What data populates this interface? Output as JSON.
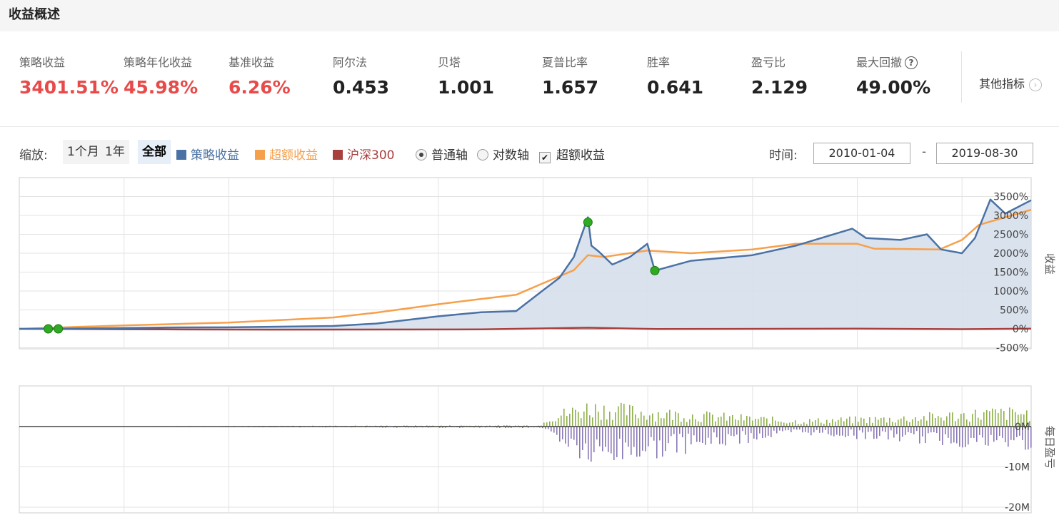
{
  "header": {
    "title": "收益概述"
  },
  "metrics": [
    {
      "label": "策略收益",
      "value": "3401.51%",
      "color": "#e84a4a"
    },
    {
      "label": "策略年化收益",
      "value": "45.98%",
      "color": "#e84a4a"
    },
    {
      "label": "基准收益",
      "value": "6.26%",
      "color": "#e84a4a"
    },
    {
      "label": "阿尔法",
      "value": "0.453",
      "color": "#222222"
    },
    {
      "label": "贝塔",
      "value": "1.001",
      "color": "#222222"
    },
    {
      "label": "夏普比率",
      "value": "1.657",
      "color": "#222222"
    },
    {
      "label": "胜率",
      "value": "0.641",
      "color": "#222222"
    },
    {
      "label": "盈亏比",
      "value": "2.129",
      "color": "#222222"
    },
    {
      "label": "最大回撤",
      "value": "49.00%",
      "color": "#222222",
      "icon": "help-icon"
    }
  ],
  "more_metrics": {
    "label": "其他指标",
    "icon": "chevron-right-circle-icon"
  },
  "toolbar": {
    "zoom_label": "缩放:",
    "zoom_buttons": [
      "1个月",
      "1年",
      "全部"
    ],
    "zoom_active": "全部",
    "legend": [
      {
        "label": "策略收益",
        "color": "#4a72a4"
      },
      {
        "label": "超额收益",
        "color": "#f7a04b"
      },
      {
        "label": "沪深300",
        "color": "#a8403e"
      }
    ],
    "axis_modes": [
      {
        "label": "普通轴",
        "checked": true
      },
      {
        "label": "对数轴",
        "checked": false
      }
    ],
    "excess_checkbox": {
      "label": "超额收益",
      "checked": true
    },
    "time_label": "时间:",
    "date_from": "2010-01-04",
    "date_to": "2019-08-30",
    "date_dash": "-"
  },
  "chart_data": [
    {
      "type": "line",
      "ylabel": "收益",
      "x_range": [
        "2010-01-04",
        "2019-08-30"
      ],
      "ylim": [
        -500,
        3500
      ],
      "yticks": [
        "3500%",
        "3000%",
        "2500%",
        "2000%",
        "1500%",
        "1000%",
        "500%",
        "0%",
        "-500%"
      ],
      "ytick_values": [
        3500,
        3000,
        2500,
        2000,
        1500,
        1000,
        500,
        0,
        -500
      ],
      "grid": true,
      "series": [
        {
          "name": "策略收益",
          "color": "#4a72a4",
          "area": true,
          "points": [
            [
              "2010-01-04",
              0
            ],
            [
              "2010-06-01",
              5
            ],
            [
              "2011-01-01",
              20
            ],
            [
              "2011-06-01",
              35
            ],
            [
              "2012-01-01",
              40
            ],
            [
              "2012-06-01",
              55
            ],
            [
              "2013-01-01",
              75
            ],
            [
              "2013-06-01",
              140
            ],
            [
              "2014-01-01",
              330
            ],
            [
              "2014-06-01",
              440
            ],
            [
              "2014-10-01",
              470
            ],
            [
              "2015-01-01",
              1010
            ],
            [
              "2015-03-01",
              1350
            ],
            [
              "2015-04-20",
              1900
            ],
            [
              "2015-06-08",
              2950
            ],
            [
              "2015-06-20",
              2200
            ],
            [
              "2015-07-15",
              2050
            ],
            [
              "2015-09-01",
              1700
            ],
            [
              "2015-11-01",
              1900
            ],
            [
              "2016-01-01",
              2250
            ],
            [
              "2016-01-27",
              1540
            ],
            [
              "2016-06-01",
              1800
            ],
            [
              "2017-01-01",
              1950
            ],
            [
              "2017-06-01",
              2200
            ],
            [
              "2017-12-15",
              2650
            ],
            [
              "2018-02-01",
              2400
            ],
            [
              "2018-06-01",
              2350
            ],
            [
              "2018-09-01",
              2500
            ],
            [
              "2018-10-20",
              2100
            ],
            [
              "2019-01-01",
              2000
            ],
            [
              "2019-02-15",
              2400
            ],
            [
              "2019-04-10",
              3420
            ],
            [
              "2019-06-01",
              3050
            ],
            [
              "2019-08-30",
              3401.51
            ]
          ]
        },
        {
          "name": "超额收益",
          "color": "#f7a04b",
          "points": [
            [
              "2010-01-04",
              0
            ],
            [
              "2011-01-01",
              90
            ],
            [
              "2012-01-01",
              165
            ],
            [
              "2013-01-01",
              300
            ],
            [
              "2013-06-01",
              430
            ],
            [
              "2014-01-01",
              650
            ],
            [
              "2014-06-01",
              790
            ],
            [
              "2014-10-01",
              900
            ],
            [
              "2015-01-01",
              1200
            ],
            [
              "2015-04-20",
              1550
            ],
            [
              "2015-06-08",
              1950
            ],
            [
              "2015-08-01",
              1900
            ],
            [
              "2016-01-01",
              2070
            ],
            [
              "2016-06-01",
              2000
            ],
            [
              "2017-01-01",
              2100
            ],
            [
              "2017-06-01",
              2250
            ],
            [
              "2018-01-01",
              2250
            ],
            [
              "2018-03-01",
              2120
            ],
            [
              "2018-10-15",
              2100
            ],
            [
              "2019-01-01",
              2350
            ],
            [
              "2019-03-01",
              2750
            ],
            [
              "2019-06-01",
              2950
            ],
            [
              "2019-08-30",
              3150
            ]
          ]
        },
        {
          "name": "沪深300",
          "color": "#a8403e",
          "points": [
            [
              "2010-01-04",
              0
            ],
            [
              "2011-06-01",
              -15
            ],
            [
              "2012-06-01",
              -20
            ],
            [
              "2014-06-01",
              -15
            ],
            [
              "2015-06-08",
              30
            ],
            [
              "2016-02-01",
              -5
            ],
            [
              "2018-01-01",
              5
            ],
            [
              "2019-01-01",
              -10
            ],
            [
              "2019-08-30",
              6.26
            ]
          ]
        }
      ],
      "markers": [
        {
          "date": "2010-04-15",
          "value": 0
        },
        {
          "date": "2010-05-20",
          "value": 0
        },
        {
          "date": "2015-06-08",
          "value": 2820
        },
        {
          "date": "2016-01-27",
          "value": 1540
        }
      ]
    },
    {
      "type": "bar",
      "ylabel": "每日盈亏",
      "ylim": [
        -20,
        5
      ],
      "yticks": [
        "0M",
        "-10M",
        "-20M"
      ],
      "ytick_values": [
        0,
        -10,
        -20
      ],
      "unit": "M",
      "positive_color": "#8fb04a",
      "negative_color": "#8a78b6",
      "description_points": [
        [
          "2015-01-01",
          3,
          -1
        ],
        [
          "2015-06-08",
          7,
          -11
        ],
        [
          "2016-01-27",
          5,
          -8
        ],
        [
          "2017-06-01",
          2,
          -2
        ],
        [
          "2018-06-01",
          3,
          -4
        ],
        [
          "2019-04-10",
          5,
          -6
        ]
      ]
    }
  ]
}
